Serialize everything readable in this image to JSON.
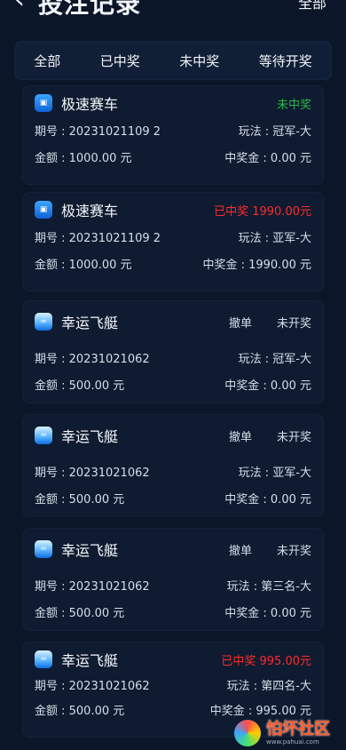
{
  "header": {
    "back_glyph": "‹",
    "title": "投注记录",
    "filter_label": "全部"
  },
  "tabs": [
    {
      "label": "全部"
    },
    {
      "label": "已中奖"
    },
    {
      "label": "未中奖"
    },
    {
      "label": "等待开奖"
    }
  ],
  "records": [
    {
      "game": "极速赛车",
      "icon": "car-icon",
      "status": "未中奖",
      "issue": "期号 : 20231021109 2",
      "play": "玩法 : 冠军-大",
      "amount": "金额 : 1000.00 元",
      "prize": "中奖金 : 0.00 元"
    },
    {
      "game": "极速赛车",
      "icon": "car-icon",
      "status": "已中奖 1990.00元",
      "issue": "期号 : 20231021109 2",
      "play": "玩法 : 亚军-大",
      "amount": "金额 : 1000.00 元",
      "prize": "中奖金 : 1990.00 元"
    },
    {
      "game": "幸运飞艇",
      "icon": "boat-icon",
      "action": "撤单",
      "status": "未开奖",
      "issue": "期号 : 20231021062",
      "play": "玩法 : 冠军-大",
      "amount": "金额 : 500.00 元",
      "prize": "中奖金 : 0.00 元"
    },
    {
      "game": "幸运飞艇",
      "icon": "boat-icon",
      "action": "撤单",
      "status": "未开奖",
      "issue": "期号 : 20231021062",
      "play": "玩法 : 亚军-大",
      "amount": "金额 : 500.00 元",
      "prize": "中奖金 : 0.00 元"
    },
    {
      "game": "幸运飞艇",
      "icon": "boat-icon",
      "action": "撤单",
      "status": "未开奖",
      "issue": "期号 : 20231021062",
      "play": "玩法 : 第三名-大",
      "amount": "金额 : 500.00 元",
      "prize": "中奖金 : 0.00 元"
    },
    {
      "game": "幸运飞艇",
      "icon": "boat-icon",
      "status": "已中奖 995.00元",
      "issue": "期号 : 20231021062",
      "play": "玩法 : 第四名-大",
      "amount": "金额 : 500.00 元",
      "prize": "中奖金 : 995.00 元"
    }
  ],
  "watermark": {
    "title": "怕坏社区",
    "url": "www.pahuai.com"
  }
}
